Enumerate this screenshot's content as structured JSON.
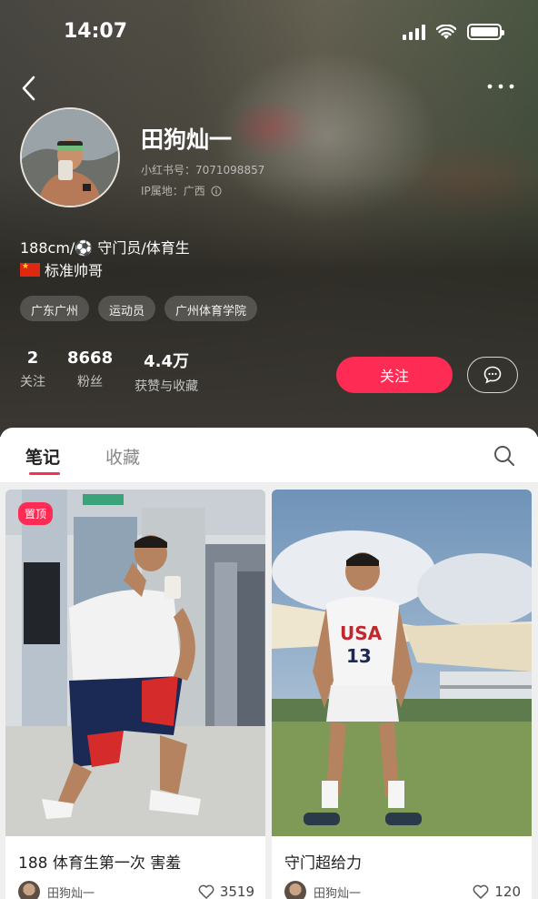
{
  "status_bar": {
    "time": "14:07"
  },
  "profile": {
    "name": "田狗灿一",
    "redbook_id": "小红书号：7071098857",
    "ip_location": "IP属地：广西",
    "bio_line1": "188cm/⚽ 守门员/体育生",
    "bio_line2": "标准帅哥",
    "tags": [
      "广东广州",
      "运动员",
      "广州体育学院"
    ]
  },
  "stats": [
    {
      "value": "2",
      "label": "关注"
    },
    {
      "value": "8668",
      "label": "粉丝"
    },
    {
      "value": "4.4万",
      "label": "获赞与收藏"
    }
  ],
  "actions": {
    "follow_label": "关注"
  },
  "tabs": [
    {
      "label": "笔记",
      "active": true
    },
    {
      "label": "收藏",
      "active": false
    }
  ],
  "notes": [
    {
      "pinned_label": "置顶",
      "title": "188 体育生第一次 害羞",
      "author": "田狗灿一",
      "likes": "3519"
    },
    {
      "title": "守门超给力",
      "author": "田狗灿一",
      "likes": "120"
    }
  ],
  "colors": {
    "accent": "#fe2c55"
  }
}
